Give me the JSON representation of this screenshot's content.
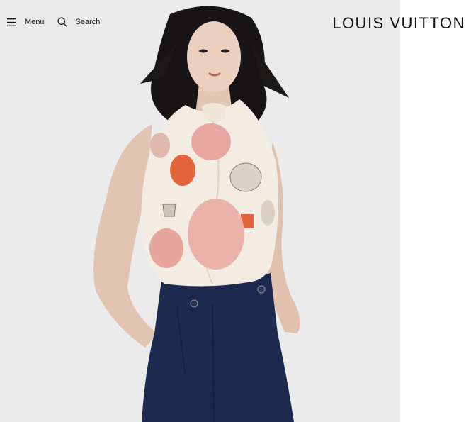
{
  "header": {
    "menu_label": "Menu",
    "menu_icon": "hamburger-icon",
    "search_label": "Search",
    "search_icon": "search-icon",
    "logo": "LOUIS VUITTON"
  },
  "hero": {
    "image": "model-wearing-printed-silk-halter-top-and-navy-trousers"
  },
  "colors": {
    "background": "#ecebeb",
    "text": "#1a1a1a",
    "trousers": "#1d2a4f",
    "print_accent": "#e2643a"
  }
}
